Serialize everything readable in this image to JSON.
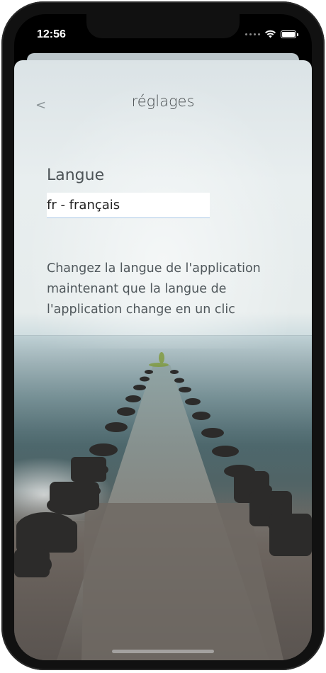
{
  "status_bar": {
    "time": "12:56",
    "icons": [
      "signal-dots-icon",
      "wifi-icon",
      "battery-icon"
    ]
  },
  "header": {
    "back_label": "<",
    "title": "réglages"
  },
  "language": {
    "label": "Langue",
    "value": "fr - français"
  },
  "description": "Changez la langue de l'application maintenant que la langue de l'application change en un clic",
  "colors": {
    "accent_underline": "#a9c7e6",
    "text_primary": "#4a4f52"
  }
}
